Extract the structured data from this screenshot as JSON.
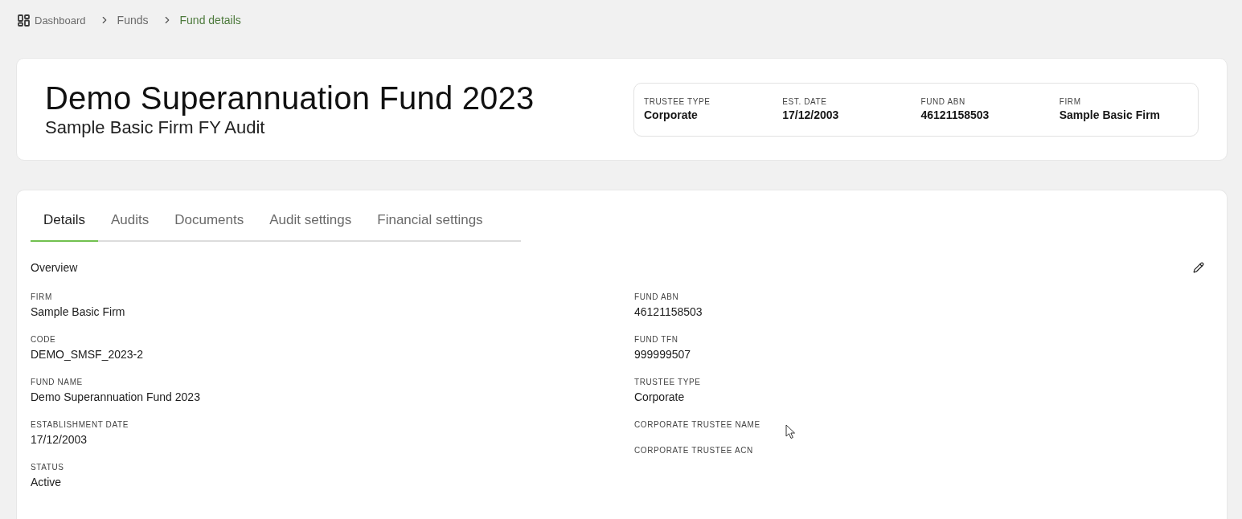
{
  "breadcrumb": [
    {
      "label": "Dashboard",
      "kind": "home"
    },
    {
      "label": "Funds",
      "kind": "link"
    },
    {
      "label": "Fund details",
      "kind": "current"
    }
  ],
  "header": {
    "title": "Demo Superannuation Fund 2023",
    "subtitle": "Sample Basic Firm FY Audit",
    "summary": [
      {
        "label": "TRUSTEE TYPE",
        "value": "Corporate"
      },
      {
        "label": "EST. DATE",
        "value": "17/12/2003"
      },
      {
        "label": "FUND ABN",
        "value": "46121158503"
      },
      {
        "label": "FIRM",
        "value": "Sample Basic Firm"
      }
    ]
  },
  "tabs": [
    {
      "label": "Details",
      "selected": true
    },
    {
      "label": "Audits",
      "selected": false
    },
    {
      "label": "Documents",
      "selected": false
    },
    {
      "label": "Audit settings",
      "selected": false
    },
    {
      "label": "Financial settings",
      "selected": false
    }
  ],
  "overview": {
    "title": "Overview",
    "left_fields": [
      {
        "label": "FIRM",
        "value": "Sample Basic Firm"
      },
      {
        "label": "CODE",
        "value": "DEMO_SMSF_2023-2"
      },
      {
        "label": "FUND NAME",
        "value": "Demo Superannuation Fund 2023"
      },
      {
        "label": "ESTABLISHMENT DATE",
        "value": "17/12/2003"
      },
      {
        "label": "STATUS",
        "value": "Active"
      }
    ],
    "right_fields": [
      {
        "label": "FUND ABN",
        "value": "46121158503"
      },
      {
        "label": "FUND TFN",
        "value": "999999507"
      },
      {
        "label": "TRUSTEE TYPE",
        "value": "Corporate"
      },
      {
        "label": "CORPORATE TRUSTEE NAME"
      },
      {
        "label": "CORPORATE TRUSTEE ACN"
      }
    ]
  }
}
